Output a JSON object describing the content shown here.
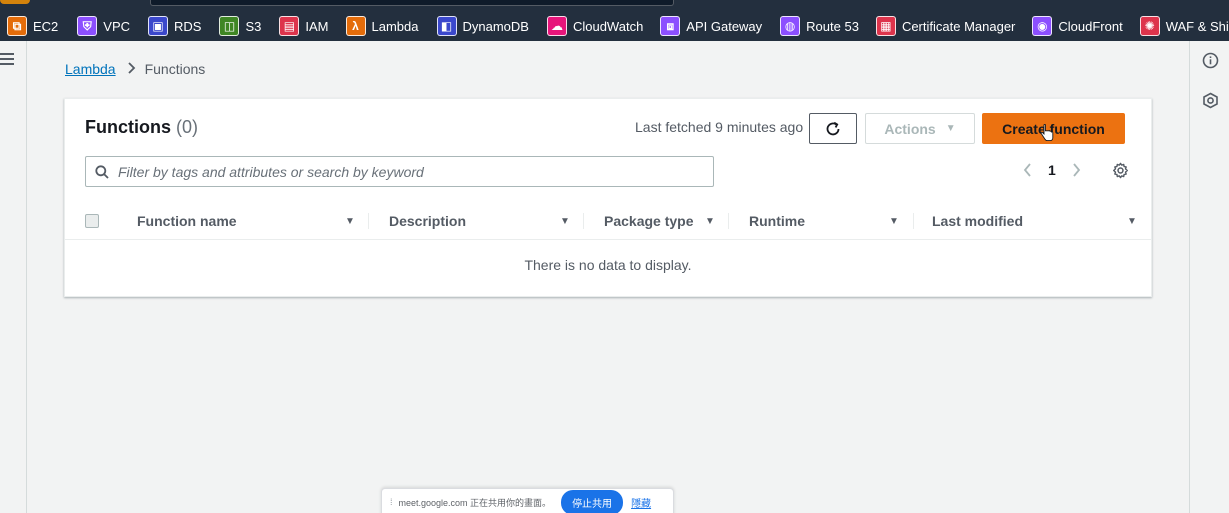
{
  "topbar": {
    "services": [
      {
        "label": "EC2",
        "icon": "ec2-icon",
        "color": "#e46c0a",
        "glyph": "⧉"
      },
      {
        "label": "VPC",
        "icon": "vpc-icon",
        "color": "#8c4fff",
        "glyph": "⛨"
      },
      {
        "label": "RDS",
        "icon": "rds-icon",
        "color": "#3b48cc",
        "glyph": "▣"
      },
      {
        "label": "S3",
        "icon": "s3-icon",
        "color": "#3f8624",
        "glyph": "◫"
      },
      {
        "label": "IAM",
        "icon": "iam-icon",
        "color": "#dd344c",
        "glyph": "▤"
      },
      {
        "label": "Lambda",
        "icon": "lambda-icon",
        "color": "#e46c0a",
        "glyph": "λ"
      },
      {
        "label": "DynamoDB",
        "icon": "dynamodb-icon",
        "color": "#3b48cc",
        "glyph": "◧"
      },
      {
        "label": "CloudWatch",
        "icon": "cloudwatch-icon",
        "color": "#e7157b",
        "glyph": "☁"
      },
      {
        "label": "API Gateway",
        "icon": "api-gateway-icon",
        "color": "#8c4fff",
        "glyph": "⧈"
      },
      {
        "label": "Route 53",
        "icon": "route53-icon",
        "color": "#8c4fff",
        "glyph": "◍"
      },
      {
        "label": "Certificate Manager",
        "icon": "certificate-manager-icon",
        "color": "#dd344c",
        "glyph": "▦"
      },
      {
        "label": "CloudFront",
        "icon": "cloudfront-icon",
        "color": "#8c4fff",
        "glyph": "◉"
      },
      {
        "label": "WAF & Shield",
        "icon": "waf-shield-icon",
        "color": "#dd344c",
        "glyph": "✺"
      }
    ]
  },
  "breadcrumb": {
    "parent": "Lambda",
    "current": "Functions"
  },
  "panel": {
    "title": "Functions",
    "count": "(0)",
    "last_fetched": "Last fetched 9 minutes ago",
    "actions_label": "Actions",
    "create_label": "Create function",
    "search_placeholder": "Filter by tags and attributes or search by keyword",
    "page": "1",
    "columns": [
      "Function name",
      "Description",
      "Package type",
      "Runtime",
      "Last modified"
    ],
    "empty_message": "There is no data to display."
  },
  "share_bar": {
    "message": "meet.google.com 正在共用你的畫面。",
    "stop_label": "停止共用",
    "hide_label": "隱藏"
  },
  "colors": {
    "accent": "#ec7211",
    "link": "#0073bb",
    "topbar": "#232f3e"
  }
}
